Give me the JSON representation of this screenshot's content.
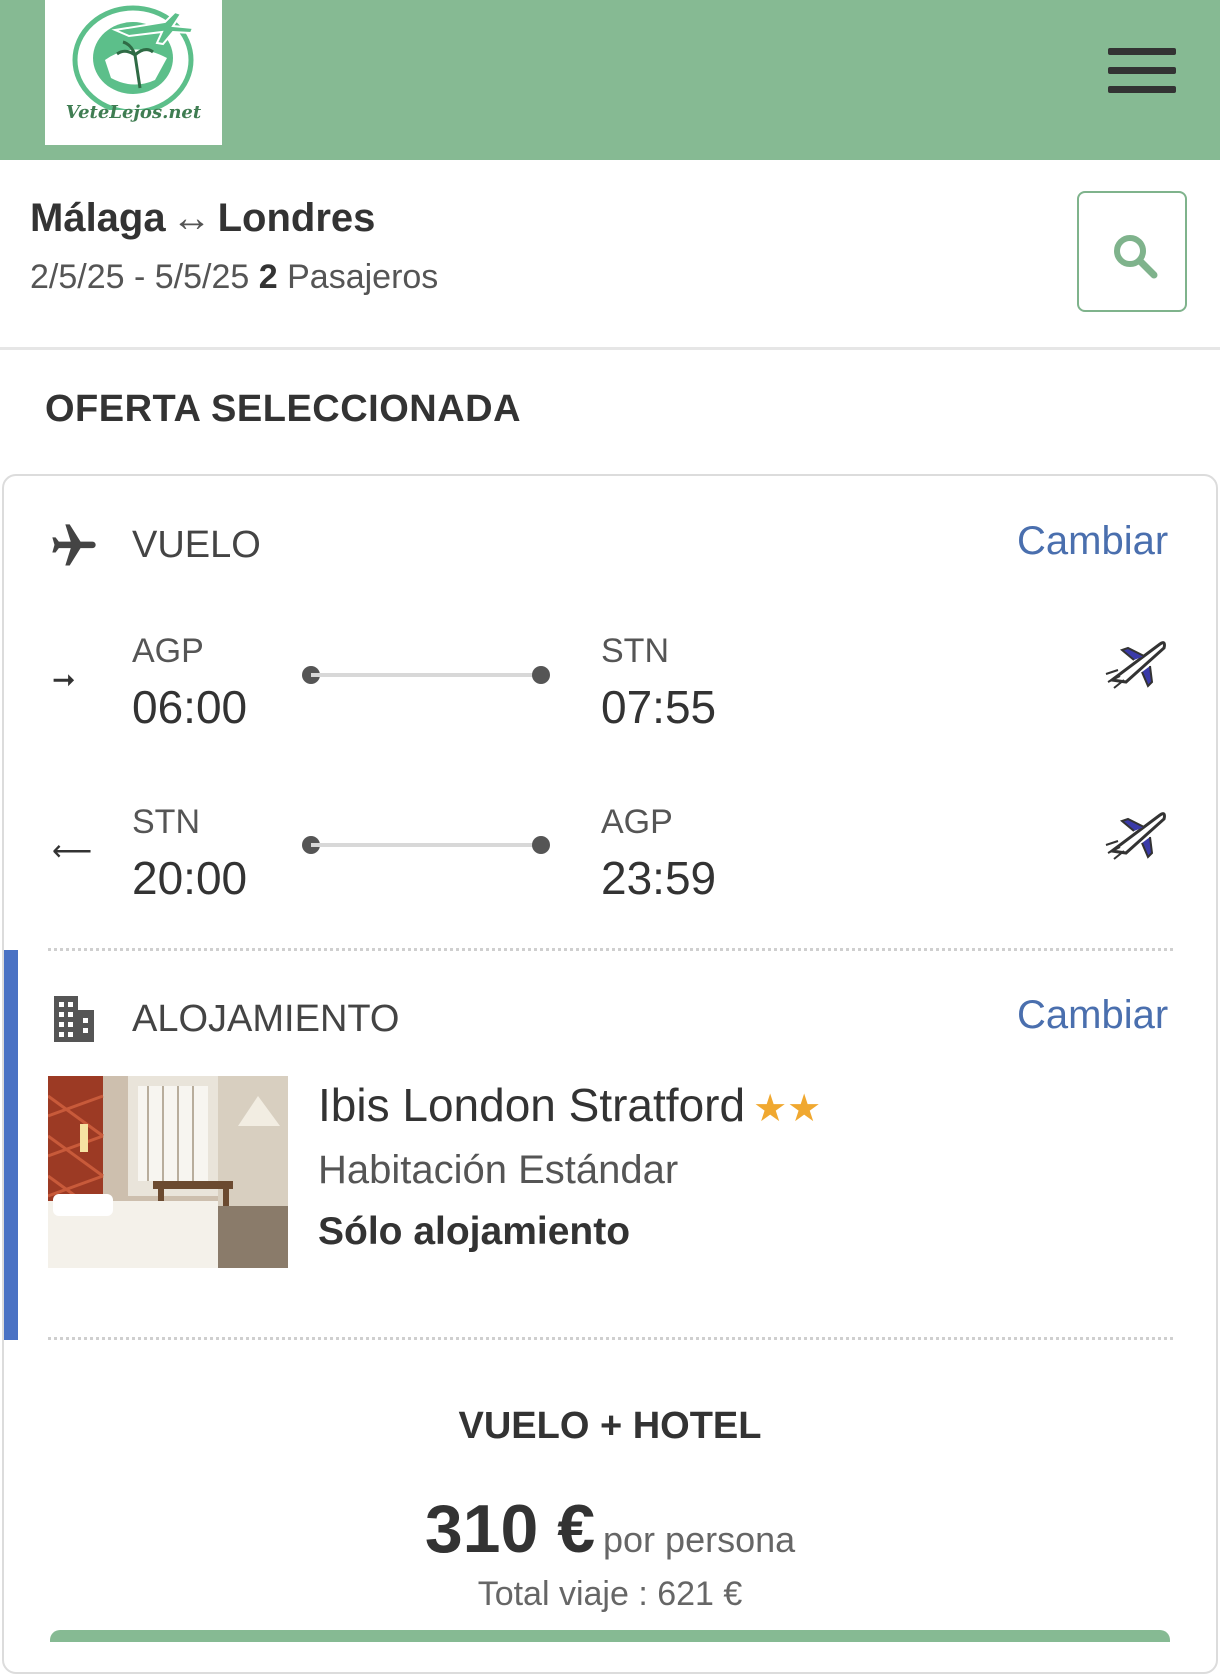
{
  "header": {
    "logo_text": "VeteLejos.net",
    "menu_icon": "hamburger-menu-icon",
    "brand_color": "#86ba93"
  },
  "search": {
    "origin": "Málaga",
    "route_arrow": "↔",
    "destination": "Londres",
    "dates": "2/5/25 - 5/5/25",
    "passengers_count": "2",
    "passengers_label": "Pasajeros",
    "search_icon": "search-icon"
  },
  "offer": {
    "section_title": "OFERTA SELECCIONADA",
    "flight": {
      "label": "VUELO",
      "change_label": "Cambiar",
      "legs": [
        {
          "direction_icon": "arrow-right-icon",
          "from_code": "AGP",
          "from_time": "06:00",
          "to_code": "STN",
          "to_time": "07:55",
          "airline_icon": "airline-plane-icon"
        },
        {
          "direction_icon": "arrow-left-icon",
          "from_code": "STN",
          "from_time": "20:00",
          "to_code": "AGP",
          "to_time": "23:59",
          "airline_icon": "airline-plane-icon"
        }
      ]
    },
    "accommodation": {
      "label": "ALOJAMIENTO",
      "change_label": "Cambiar",
      "hotel_name": "Ibis London Stratford",
      "stars": 2,
      "room_type": "Habitación Estándar",
      "board": "Sólo alojamiento",
      "accent_color": "#4a72c4"
    },
    "price": {
      "package_label": "VUELO + HOTEL",
      "per_person": "310 €",
      "per_person_label": "por persona",
      "total": "Total viaje : 621 €"
    }
  }
}
